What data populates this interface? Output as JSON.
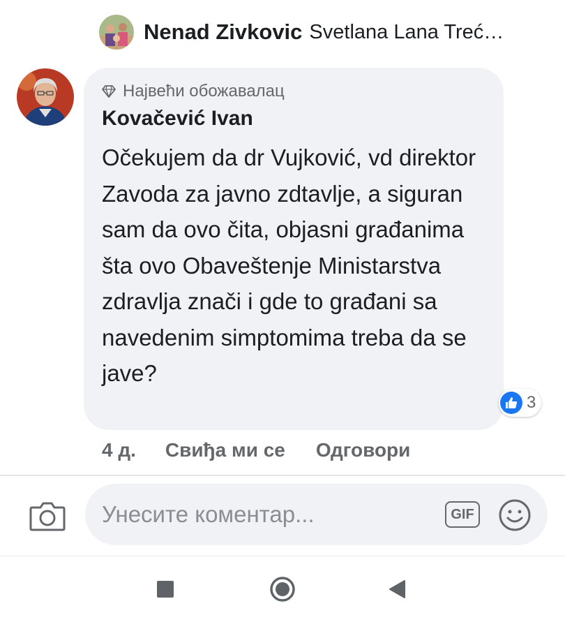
{
  "reacted_row": {
    "name": "Nenad Zivkovic",
    "others": "Svetlana Lana Treć…",
    "avatar_icon": "group-photo-avatar"
  },
  "comment": {
    "avatar_icon": "user-avatar",
    "badge_icon": "diamond-icon",
    "badge_label": "Највећи обожавалац",
    "author": "Kovačević Ivan",
    "text": "Očekujem da dr Vujković, vd direktor Zavoda za javno zdtavlje, a siguran sam da ovo čita, objasni građanima šta ovo Obaveštenje Ministarstva zdravlja znači i gde to građani sa navedenim simptomima treba da se jave?",
    "reaction_icon": "like-icon",
    "reaction_count": "3",
    "time": "4 д.",
    "like_label": "Свиђа ми се",
    "reply_label": "Одговори"
  },
  "composer": {
    "camera_icon": "camera-icon",
    "placeholder": "Унесите коментар...",
    "gif_label": "GIF",
    "emoji_icon": "smiley-icon"
  },
  "navbar": {
    "recents_icon": "square-icon",
    "home_icon": "circle-icon",
    "back_icon": "back-triangle-icon"
  },
  "colors": {
    "bubble_bg": "#f0f2f5",
    "secondary_text": "#65676b",
    "like_blue": "#1877f2"
  }
}
